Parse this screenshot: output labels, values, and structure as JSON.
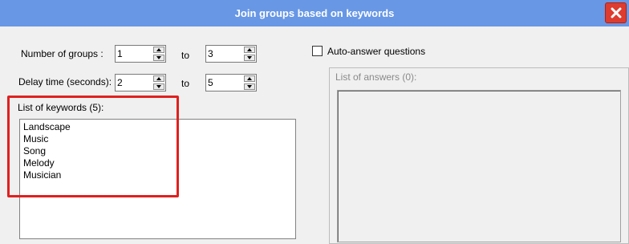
{
  "window": {
    "title": "Join groups based on keywords"
  },
  "groups": {
    "label": "Number of groups :",
    "from": "1",
    "to_label": "to",
    "to": "3"
  },
  "delay": {
    "label": "Delay time (seconds):",
    "from": "2",
    "to_label": "to",
    "to": "5"
  },
  "keywords": {
    "label": "List of keywords (5):",
    "items": [
      "Landscape",
      "Music",
      "Song",
      "Melody",
      "Musician"
    ]
  },
  "auto_answer": {
    "label": "Auto-answer questions",
    "checked": false
  },
  "answers": {
    "label": "List of answers (0):"
  },
  "colors": {
    "titlebar": "#6797e5",
    "close": "#dd3c2e",
    "highlight": "#e02020"
  },
  "icons": {
    "close": "close-icon",
    "spin_up": "arrow-up-icon",
    "spin_down": "arrow-down-icon"
  }
}
